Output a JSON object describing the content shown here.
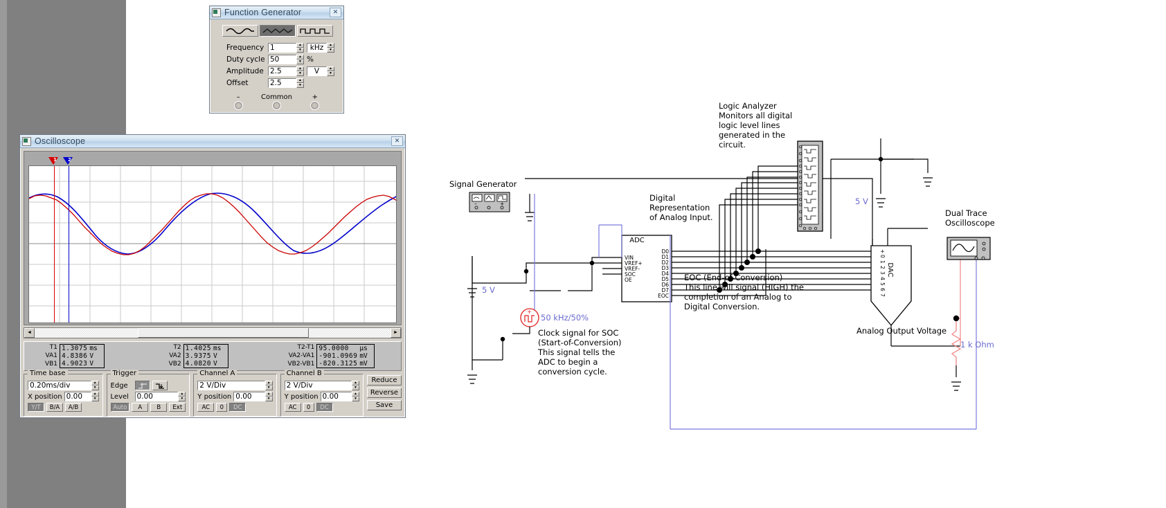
{
  "function_generator": {
    "title": "Function Generator",
    "close_label": "✕",
    "waveforms": [
      {
        "name": "sine",
        "selected": false
      },
      {
        "name": "triangle",
        "selected": true
      },
      {
        "name": "square",
        "selected": false
      }
    ],
    "fields": [
      {
        "label": "Frequency",
        "value": "1",
        "unit": "kHz",
        "unit_type": "select"
      },
      {
        "label": "Duty cycle",
        "value": "50",
        "unit": "%",
        "unit_type": "text"
      },
      {
        "label": "Amplitude",
        "value": "2.5",
        "unit": "V",
        "unit_type": "select"
      },
      {
        "label": "Offset",
        "value": "2.5",
        "unit": "",
        "unit_type": "none"
      }
    ],
    "terminals": [
      {
        "label": "–"
      },
      {
        "label": "Common"
      },
      {
        "label": "+"
      }
    ]
  },
  "oscilloscope": {
    "title": "Oscilloscope",
    "close_label": "✕",
    "cursors": [
      {
        "id": "1",
        "color": "#d50000"
      },
      {
        "id": "2",
        "color": "#0000cc"
      }
    ],
    "measurements": {
      "col1": {
        "rows": [
          {
            "label": "T1",
            "value": "1.3075",
            "unit": "ms"
          },
          {
            "label": "VA1",
            "value": "4.8386",
            "unit": "V"
          },
          {
            "label": "VB1",
            "value": "4.9023",
            "unit": "V"
          }
        ]
      },
      "col2": {
        "rows": [
          {
            "label": "T2",
            "value": "1.4025",
            "unit": "ms"
          },
          {
            "label": "VA2",
            "value": "3.9375",
            "unit": "V"
          },
          {
            "label": "VB2",
            "value": "4.0820",
            "unit": "V"
          }
        ]
      },
      "col3": {
        "rows": [
          {
            "label": "T2-T1",
            "value": "95.0000",
            "unit": "µs"
          },
          {
            "label": "VA2-VA1",
            "value": "-901.0969",
            "unit": "mV"
          },
          {
            "label": "VB2-VB1",
            "value": "-820.3125",
            "unit": "mV"
          }
        ]
      }
    },
    "timebase": {
      "legend": "Time base",
      "scale": "0.20ms/div",
      "xposition_label": "X position",
      "xposition": "0.00",
      "modes": [
        {
          "label": "Y/T",
          "active": true
        },
        {
          "label": "B/A",
          "active": false
        },
        {
          "label": "A/B",
          "active": false
        }
      ]
    },
    "trigger": {
      "legend": "Trigger",
      "edge_label": "Edge",
      "edges": [
        {
          "name": "rising-edge",
          "active": true
        },
        {
          "name": "falling-edge",
          "active": false
        }
      ],
      "level_label": "Level",
      "level": "0.00",
      "sources": [
        {
          "label": "Auto",
          "active": true
        },
        {
          "label": "A",
          "active": false
        },
        {
          "label": "B",
          "active": false
        },
        {
          "label": "Ext",
          "active": false
        }
      ]
    },
    "channel_a": {
      "legend": "Channel A",
      "scale": "2 V/Div",
      "yposition_label": "Y position",
      "yposition": "0.00",
      "coupling": [
        {
          "label": "AC",
          "active": false
        },
        {
          "label": "0",
          "active": false
        },
        {
          "label": "DC",
          "active": true
        }
      ]
    },
    "channel_b": {
      "legend": "Channel B",
      "scale": "2 V/Div",
      "yposition_label": "Y position",
      "yposition": "0.00",
      "coupling": [
        {
          "label": "AC",
          "active": false
        },
        {
          "label": "0",
          "active": false
        },
        {
          "label": "DC",
          "active": true
        }
      ]
    },
    "side_buttons": [
      {
        "label": "Reduce"
      },
      {
        "label": "Reverse"
      },
      {
        "label": "Save"
      }
    ]
  },
  "circuit": {
    "labels": {
      "signal_generator": "Signal Generator",
      "logic_analyzer": "Logic Analyzer\nMonitors all digital\nlogic level lines\ngenerated in the\ncircuit.",
      "logic_analyzer_lines": [
        "Logic Analyzer",
        "Monitors all digital",
        "logic level lines",
        "generated in the",
        "circuit."
      ],
      "digital_rep_lines": [
        "Digital",
        "Representation",
        "of Analog Input."
      ],
      "eoc_lines": [
        "EOC (End-of-Conversion)",
        "This line will signal (HIGH) the",
        "completion of an Analog to",
        "Digital Conversion."
      ],
      "clock_lines": [
        "Clock signal for SOC",
        "(Start-of-Conversion)",
        "This signal tells the",
        "ADC to begin a",
        "conversion cycle."
      ],
      "dual_trace_lines": [
        "Dual Trace",
        "Oscilloscope"
      ],
      "analog_output_voltage": "Analog Output Voltage",
      "clock_spec": "50 kHz/50%",
      "supply_5v_left": "5 V",
      "supply_5v_right": "5 V",
      "resistor": "1 k Ohm",
      "adc_title": "ADC",
      "dac_title": "DAC",
      "adc_inputs": [
        "VIN",
        "VREF+",
        "VREF-",
        "SOC",
        "OE"
      ],
      "adc_outputs": [
        "D0",
        "D1",
        "D2",
        "D3",
        "D4",
        "D5",
        "D6",
        "D7",
        "EOC"
      ],
      "dac_pins": [
        "+",
        "0",
        "1",
        "2",
        "3",
        "4",
        "5",
        "6",
        "7"
      ]
    },
    "colors": {
      "wire_black": "#000000",
      "wire_blue": "#7a7ade",
      "wire_red": "#ef8585",
      "clock_red": "#e02020",
      "text_blue": "#6a6ad0"
    }
  }
}
